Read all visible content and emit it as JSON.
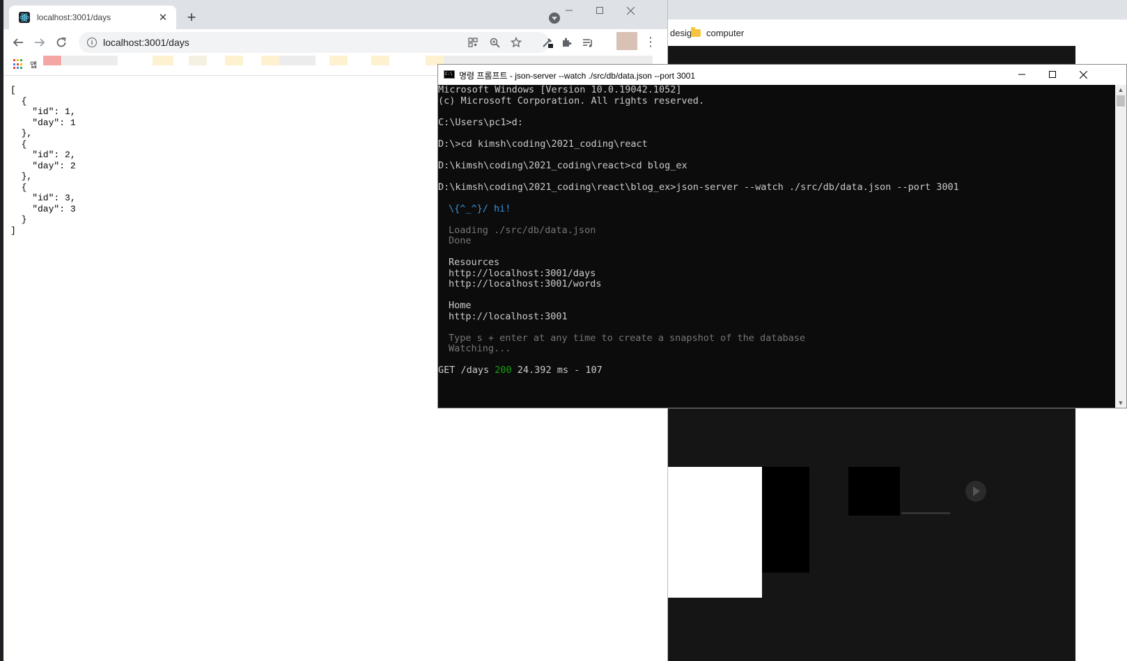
{
  "background_window": {
    "bookmarks": [
      "design",
      "computer"
    ]
  },
  "browser": {
    "tab_title": "localhost:3001/days",
    "tab_close": "✕",
    "new_tab": "+",
    "url": "localhost:3001/days",
    "bookmark_apps_label": "앱",
    "json_body": "[\n  {\n    \"id\": 1,\n    \"day\": 1\n  },\n  {\n    \"id\": 2,\n    \"day\": 2\n  },\n  {\n    \"id\": 3,\n    \"day\": 3\n  }\n]"
  },
  "cmd": {
    "title": "명령 프롬프트 - json-server  --watch ./src/db/data.json --port 3001",
    "lines": {
      "l1": "Microsoft Windows [Version 10.0.19042.1052]",
      "l2": "(c) Microsoft Corporation. All rights reserved.",
      "l3": "C:\\Users\\pc1>d:",
      "l4": "D:\\>cd kimsh\\coding\\2021_coding\\react",
      "l5": "D:\\kimsh\\coding\\2021_coding\\react>cd blog_ex",
      "l6": "D:\\kimsh\\coding\\2021_coding\\react\\blog_ex>json-server --watch ./src/db/data.json --port 3001",
      "l7": "\\{^_^}/ hi!",
      "l8": "Loading ./src/db/data.json",
      "l9": "Done",
      "l10": "Resources",
      "l11": "http://localhost:3001/days",
      "l12": "http://localhost:3001/words",
      "l13": "Home",
      "l14": "http://localhost:3001",
      "l15": "Type s + enter at any time to create a snapshot of the database",
      "l16": "Watching...",
      "l17_method": "GET /days ",
      "l17_status": "200",
      "l17_rest": " 24.392 ms - 107"
    }
  },
  "colors": {
    "cmd_background": "#0c0c0c",
    "cmd_text": "#cccccc",
    "cmd_blue": "#3a96dd",
    "cmd_gray": "#767676",
    "cmd_green": "#13a10e",
    "chrome_tabstrip": "#dee1e6"
  }
}
